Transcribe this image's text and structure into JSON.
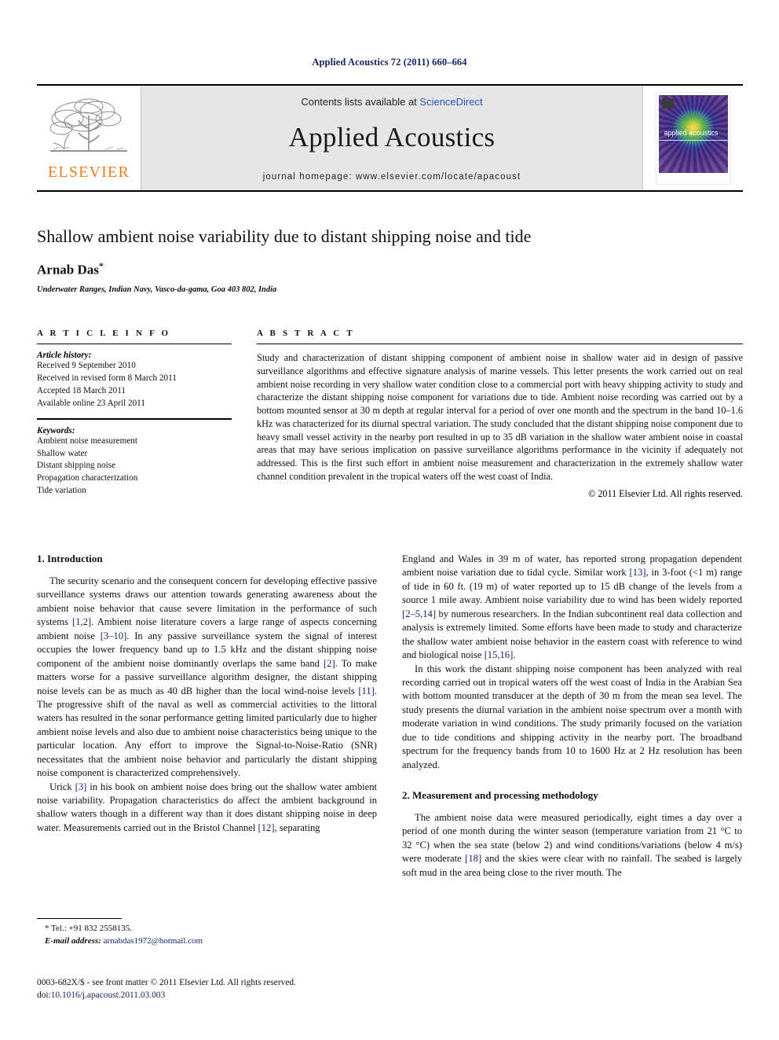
{
  "running_head": "Applied Acoustics 72 (2011) 660–664",
  "masthead": {
    "publisher_name": "ELSEVIER",
    "contents_prefix": "Contents lists available at ",
    "sciencedirect": "ScienceDirect",
    "journal_name": "Applied Acoustics",
    "homepage": "journal homepage: www.elsevier.com/locate/apacoust",
    "cover_title": "applied acoustics"
  },
  "title": "Shallow ambient noise variability due to distant shipping noise and tide",
  "author": "Arnab Das",
  "author_marker": "*",
  "affiliation": "Underwater Ranges, Indian Navy, Vasco-da-gama, Goa 403 802, India",
  "article_info": {
    "label": "A R T I C L E    I N F O",
    "history_label": "Article history:",
    "history": [
      "Received 9 September 2010",
      "Received in revised form 8 March 2011",
      "Accepted 18 March 2011",
      "Available online 23 April 2011"
    ],
    "keywords_label": "Keywords:",
    "keywords": [
      "Ambient noise measurement",
      "Shallow water",
      "Distant shipping noise",
      "Propagation characterization",
      "Tide variation"
    ]
  },
  "abstract": {
    "label": "A B S T R A C T",
    "text": "Study and characterization of distant shipping component of ambient noise in shallow water aid in design of passive surveillance algorithms and effective signature analysis of marine vessels. This letter presents the work carried out on real ambient noise recording in very shallow water condition close to a commercial port with heavy shipping activity to study and characterize the distant shipping noise component for variations due to tide. Ambient noise recording was carried out by a bottom mounted sensor at 30 m depth at regular interval for a period of over one month and the spectrum in the band 10–1.6 kHz was characterized for its diurnal spectral variation. The study concluded that the distant shipping noise component due to heavy small vessel activity in the nearby port resulted in up to 35 dB variation in the shallow water ambient noise in coastal areas that may have serious implication on passive surveillance algorithms performance in the vicinity if adequately not addressed. This is the first such effort in ambient noise measurement and characterization in the extremely shallow water channel condition prevalent in the tropical waters off the west coast of India.",
    "copyright": "© 2011 Elsevier Ltd. All rights reserved."
  },
  "sections": {
    "intro_heading": "1. Introduction",
    "methodology_heading": "2. Measurement and processing methodology"
  },
  "left_column": {
    "p1_a": "The security scenario and the consequent concern for developing effective passive surveillance systems draws our attention towards generating awareness about the ambient noise behavior that cause severe limitation in the performance of such systems ",
    "p1_c1": "[1,2]",
    "p1_b": ". Ambient noise literature covers a large range of aspects concerning ambient noise ",
    "p1_c2": "[3–10]",
    "p1_c": ". In any passive surveillance system the signal of interest occupies the lower frequency band up to 1.5 kHz and the distant shipping noise component of the ambient noise dominantly overlaps the same band ",
    "p1_c3": "[2]",
    "p1_d": ". To make matters worse for a passive surveillance algorithm designer, the distant shipping noise levels can be as much as 40 dB higher than the local wind-noise levels ",
    "p1_c4": "[11]",
    "p1_e": ". The progressive shift of the naval as well as commercial activities to the littoral waters has resulted in the sonar performance getting limited particularly due to higher ambient noise levels and also due to ambient noise characteristics being unique to the particular location. Any effort to improve the Signal-to-Noise-Ratio (SNR) necessitates that the ambient noise behavior and particularly the distant shipping noise component is characterized comprehensively.",
    "p2_a": "Urick ",
    "p2_c1": "[3]",
    "p2_b": " in his book on ambient noise does bring out the shallow water ambient noise variability. Propagation characteristics do affect the ambient background in shallow waters though in a different way than it does distant shipping noise in deep water. Measurements carried out in the Bristol Channel ",
    "p2_c2": "[12]",
    "p2_c": ", separating"
  },
  "right_column": {
    "p1_a": "England and Wales in 39 m of water, has reported strong propagation dependent ambient noise variation due to tidal cycle. Similar work ",
    "p1_c1": "[13]",
    "p1_b": ", in 3-foot (<1 m) range of tide in 60 ft. (19 m) of water reported up to 15 dB change of the levels from a source 1 mile away. Ambient noise variability due to wind has been widely reported ",
    "p1_c2": "[2–5,14]",
    "p1_c": " by numerous researchers. In the Indian subcontinent real data collection and analysis is extremely limited. Some efforts have been made to study and characterize the shallow water ambient noise behavior in the eastern coast with reference to wind and biological noise ",
    "p1_c3": "[15,16]",
    "p1_d": ".",
    "p2": "In this work the distant shipping noise component has been analyzed with real recording carried out in tropical waters off the west coast of India in the Arabian Sea with bottom mounted transducer at the depth of 30 m from the mean sea level. The study presents the diurnal variation in the ambient noise spectrum over a month with moderate variation in wind conditions. The study primarily focused on the variation due to tide conditions and shipping activity in the nearby port. The broadband spectrum for the frequency bands from 10 to 1600 Hz at 2 Hz resolution has been analyzed.",
    "p3_a": "The ambient noise data were measured periodically, eight times a day over a period of one month during the winter season (temperature variation from 21 °C to 32 °C) when the sea state (below 2) and wind conditions/variations (below 4 m/s) were moderate ",
    "p3_c1": "[18]",
    "p3_b": " and the skies were clear with no rainfall. The seabed is largely soft mud in the area being close to the river mouth. The"
  },
  "footnote": {
    "tel": "* Tel.: +91 832 2558135.",
    "email_label": "E-mail address:",
    "email": "arnabdas1972@hotmail.com"
  },
  "colophon": {
    "issn_line": "0003-682X/$ - see front matter © 2011 Elsevier Ltd. All rights reserved.",
    "doi_label": "doi:",
    "doi_value": "10.1016/j.apacoust.2011.03.003"
  },
  "colors": {
    "link_blue": "#15256b",
    "sciencedirect_blue": "#2a4fb7",
    "elsevier_orange": "#f07c1a",
    "mast_grey": "#e6e6e6"
  }
}
